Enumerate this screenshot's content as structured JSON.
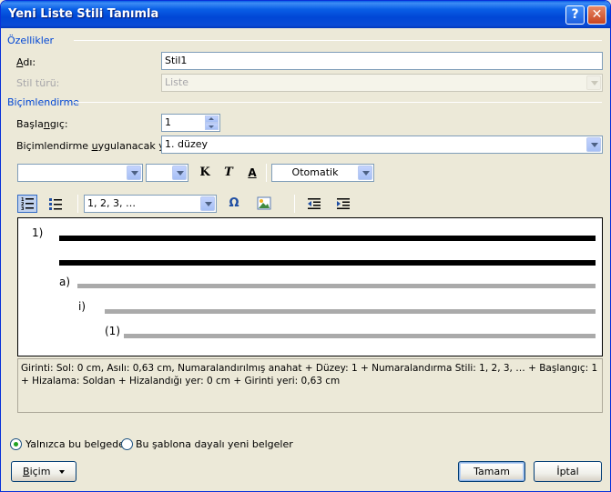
{
  "window": {
    "title": "Yeni Liste Stili Tanımla"
  },
  "sections": {
    "properties": "Özellikler",
    "formatting": "Biçimlendirme"
  },
  "properties": {
    "name_label_pre": "",
    "name_label_ul": "A",
    "name_label_post": "dı:",
    "name_value": "Stil1",
    "style_type_label": "Stil türü:",
    "style_type_value": "Liste"
  },
  "formatting": {
    "start_label_pre": "Başla",
    "start_label_ul": "n",
    "start_label_post": "gıç:",
    "start_value": "1",
    "apply_label_pre": "Biçimlendirme ",
    "apply_label_ul": "u",
    "apply_label_post": "ygulanacak yer:",
    "apply_value": "1. düzey",
    "font_value": "",
    "size_value": "",
    "bold_glyph": "K",
    "italic_glyph": "T",
    "underline_glyph": "A",
    "color_value": "Otomatik",
    "numbering_style_value": "1, 2, 3, …",
    "symbol_glyph": "Ω"
  },
  "preview": {
    "level1": "1)",
    "level2": "a)",
    "level3": "i)",
    "level4": "(1)"
  },
  "description": "Girinti: Sol:  0 cm, Asılı:  0,63 cm, Numaralandırılmış anahat + Düzey: 1 + Numaralandırma Stili: 1, 2, 3, … + Başlangıç: 1 + Hizalama: Soldan + Hizalandığı yer:  0 cm + Girinti yeri:  0,63 cm",
  "options": {
    "this_doc_label": "Yalnızca bu belgede",
    "template_label": "Bu şablona dayalı yeni belgeler"
  },
  "buttons": {
    "format_label_ul": "B",
    "format_label_post": "içim",
    "ok_label": "Tamam",
    "cancel_label": "İptal"
  },
  "icons": {
    "help": "help-icon",
    "close": "close-icon",
    "bold": "bold-icon",
    "italic": "italic-icon",
    "font_color": "font-color-icon",
    "numbered_list": "numbered-list-icon",
    "bulleted_list": "bulleted-list-icon",
    "symbol": "symbol-icon",
    "picture": "picture-icon",
    "decrease_indent": "decrease-indent-icon",
    "increase_indent": "increase-indent-icon",
    "dropdown": "chevron-down-icon"
  }
}
